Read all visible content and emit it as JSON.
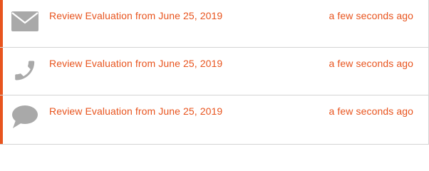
{
  "notifications": [
    {
      "icon": "envelope-icon",
      "title": "Review Evaluation from June 25, 2019",
      "time": "a few seconds ago"
    },
    {
      "icon": "phone-icon",
      "title": "Review Evaluation from June 25, 2019",
      "time": "a few seconds ago"
    },
    {
      "icon": "speech-bubble-icon",
      "title": "Review Evaluation from June 25, 2019",
      "time": "a few seconds ago"
    }
  ],
  "colors": {
    "accent": "#e8541e",
    "icon": "#a9a9a9",
    "divider": "#d4d4d4"
  }
}
